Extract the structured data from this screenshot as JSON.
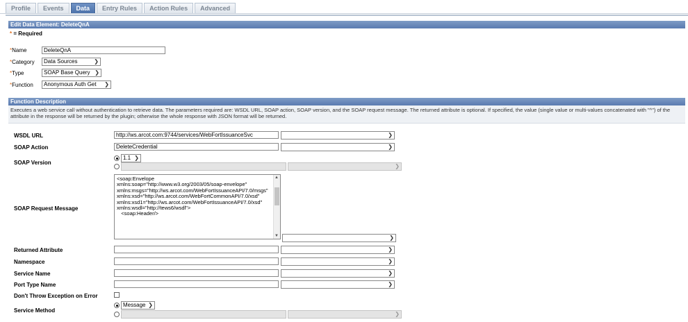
{
  "tabs": [
    {
      "label": "Profile"
    },
    {
      "label": "Events"
    },
    {
      "label": "Data"
    },
    {
      "label": "Entry Rules"
    },
    {
      "label": "Action Rules"
    },
    {
      "label": "Advanced"
    }
  ],
  "edit_header": "Edit Data Element: DeleteQnA",
  "required_star": "*",
  "required_text": " = Required",
  "fields": {
    "name": {
      "label": "Name",
      "value": "DeleteQnA"
    },
    "category": {
      "label": "Category",
      "value": "Data Sources"
    },
    "type": {
      "label": "Type",
      "value": "SOAP Base Query"
    },
    "function": {
      "label": "Function",
      "value": "Anonymous Auth Get"
    }
  },
  "function_description": {
    "header": "Function Description",
    "text": "Executes a web service call without authentication to retrieve data. The parameters required are: WSDL URL, SOAP action, SOAP version, and the SOAP request message. The returned attribute is optional. If specified, the value (single value or multi-values concatenated with \"^\") of the attribute in the response will be returned by the plugin; otherwise the whole response with JSON format will be returned."
  },
  "params": {
    "wsdl_url": {
      "label": "WSDL URL",
      "value": "http://ws.arcot.com:9744/services/WebFortIssuanceSvc"
    },
    "soap_action": {
      "label": "SOAP Action",
      "value": "DeleteCredential"
    },
    "soap_version": {
      "label": "SOAP Version",
      "value": "1.1"
    },
    "soap_request": {
      "label": "SOAP Request Message",
      "value": "<soap:Envelope\nxmlns:soap=\"http://www.w3.org/2003/05/soap-envelope\"\nxmlns:msgs=\"http://ws.arcot.com/WebFortIssuanceAPI/7.0/msgs\"\nxmlns:xsd=\"http://ws.arcot.com/WebFortCommonAPI/7.0/xsd\"\nxmlns:xsd1=\"http://ws.arcot.com/WebFortIssuanceAPI/7.0/xsd\" xmlns:wsdl=\"http://tews6/wsdl\">\n   <soap:Header/>"
    },
    "returned_attribute": {
      "label": "Returned Attribute",
      "value": ""
    },
    "namespace": {
      "label": "Namespace",
      "value": ""
    },
    "service_name": {
      "label": "Service Name",
      "value": ""
    },
    "port_type_name": {
      "label": "Port Type Name",
      "value": ""
    },
    "dont_throw": {
      "label": "Don't Throw Exception on Error"
    },
    "service_method": {
      "label": "Service Method",
      "value": "Message"
    }
  },
  "icons": {
    "chevron": "chevron-down-icon"
  }
}
